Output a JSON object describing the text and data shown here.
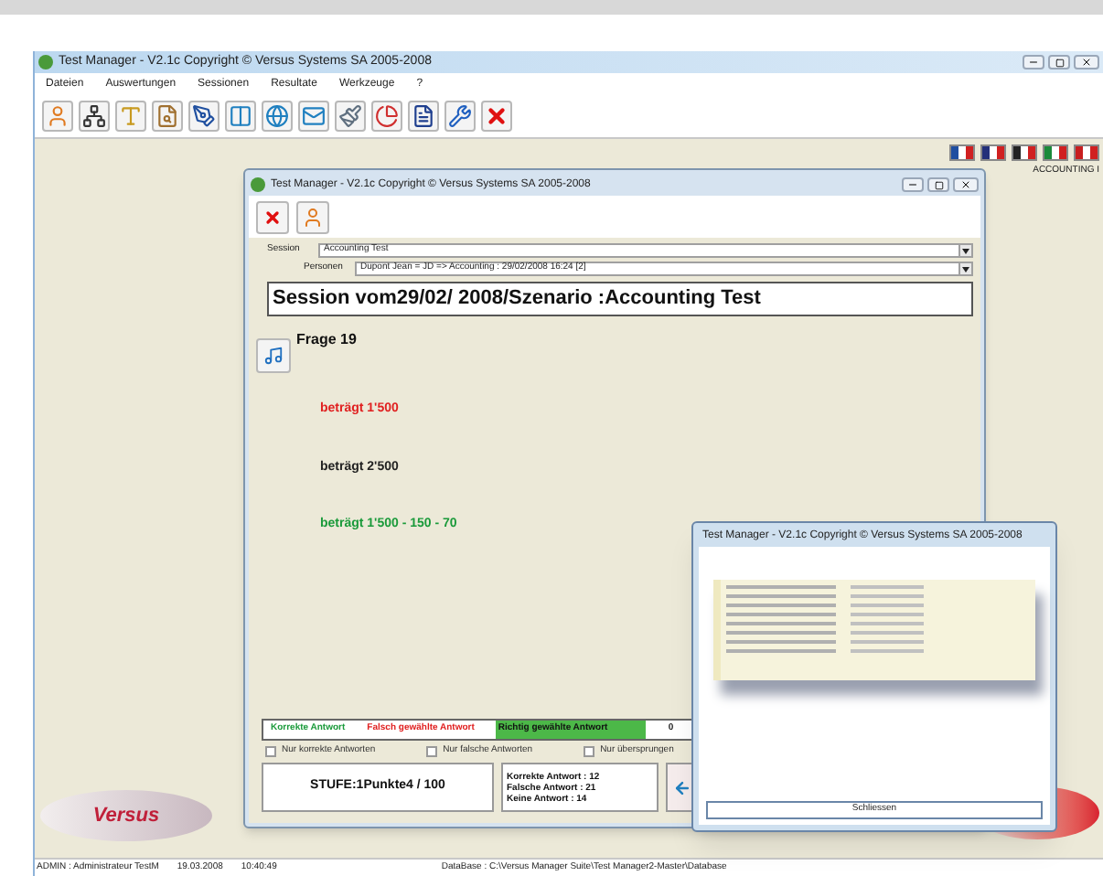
{
  "main_window": {
    "title": "Test Manager - V2.1c Copyright © Versus Systems SA 2005-2008",
    "menu": [
      "Dateien",
      "Auswertungen",
      "Sessionen",
      "Resultate",
      "Werkzeuge",
      "?"
    ],
    "corner_label": "ACCOUNTING I"
  },
  "session_window": {
    "title": "Test Manager - V2.1c Copyright © Versus Systems SA 2005-2008",
    "fields": [
      {
        "label": "Session",
        "value": "Accounting Test"
      },
      {
        "label": "Personen",
        "value": "Dupont Jean = JD =>  Accounting : 29/02/2008 16:24 [2]"
      }
    ],
    "heading": "Session vom29/02/ 2008/Szenario :Accounting Test",
    "question": "Frage 19",
    "answers": [
      {
        "text": "beträgt 1'500",
        "color": "#e02020"
      },
      {
        "text": "beträgt 2'500",
        "color": "#222222"
      },
      {
        "text": "beträgt 1'500 - 150 - 70",
        "color": "#1a9a3a"
      }
    ],
    "legend": [
      {
        "kind": "text",
        "label": "Korrekte Antwort",
        "color": "#1a9a3a"
      },
      {
        "kind": "text",
        "label": "Falsch gewählte Antwort",
        "color": "#e02020"
      },
      {
        "kind": "fill",
        "label": "Richtig gewählte Antwort",
        "color": "#4cb848"
      }
    ],
    "legend_count": "0",
    "filters": [
      {
        "label": "Nur korrekte Antworten",
        "checked": false
      },
      {
        "label": "Nur falsche Antworten",
        "checked": false
      },
      {
        "label": "Nur übersprungen",
        "checked": false
      }
    ],
    "score": "STUFE:1Punkte4 / 100",
    "stats": [
      "Korrekte Antwort : 12",
      "Falsche Antwort : 21",
      "Keine Antwort : 14"
    ]
  },
  "popup": {
    "title": "Test Manager - V2.1c Copyright © Versus Systems SA 2005-2008",
    "button": "Schliessen"
  },
  "logos": {
    "left": "Versus"
  },
  "status_bar": [
    "ADMIN : Administrateur TestM",
    "19.03.2008",
    "10:40:49",
    "DataBase : C:\\Versus Manager Suite\\Test Manager2-Master\\Database"
  ]
}
